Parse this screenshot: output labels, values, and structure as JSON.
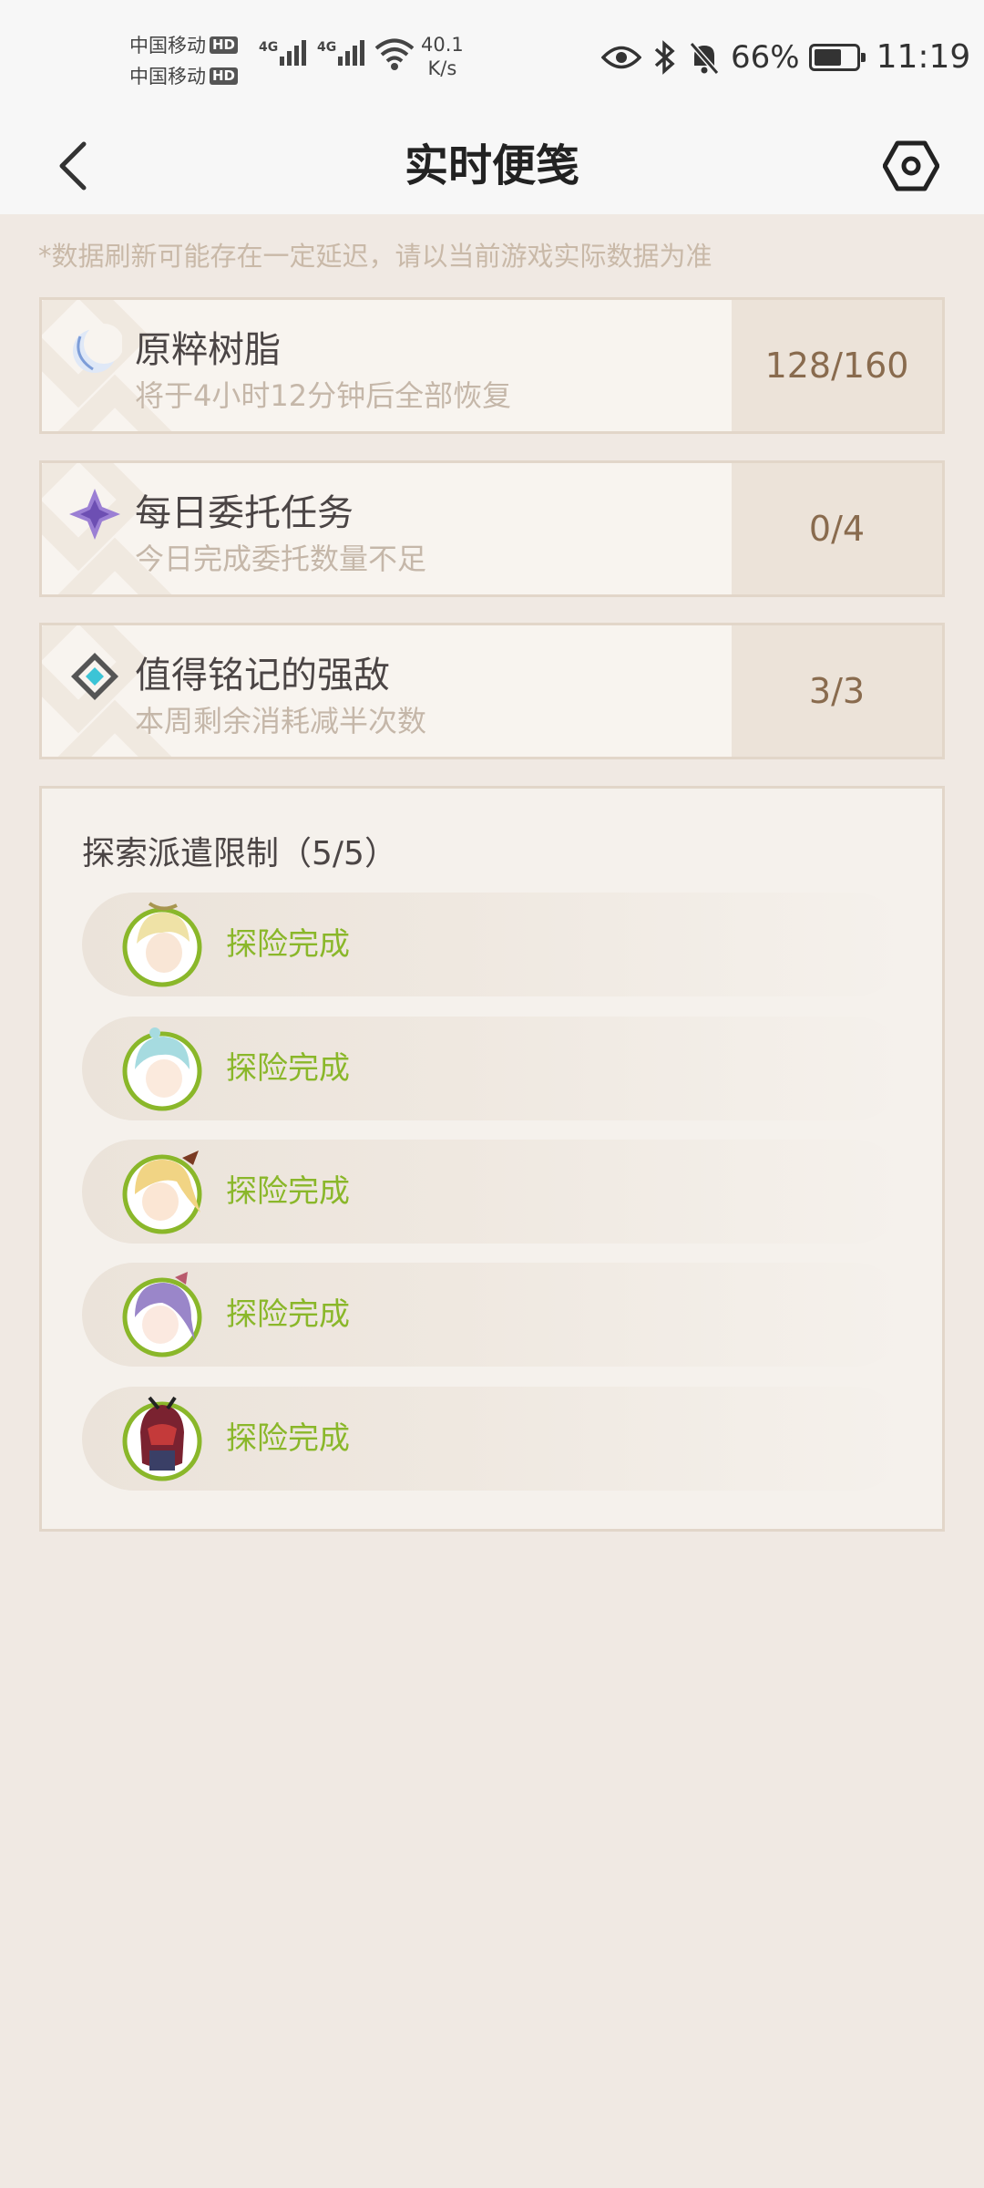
{
  "status_bar": {
    "carrier1": "中国移动",
    "carrier2": "中国移动",
    "hd_badge": "HD",
    "network_type": "4G",
    "net_speed_value": "40.1",
    "net_speed_unit": "K/s",
    "battery_percent": "66%",
    "battery_level": 0.66,
    "time": "11:19"
  },
  "header": {
    "title": "实时便笺",
    "back_icon": "chevron-left-icon",
    "settings_icon": "hexagon-gear-icon"
  },
  "notice": "*数据刷新可能存在一定延迟，请以当前游戏实际数据为准",
  "cards": [
    {
      "icon": "moon-resin-icon",
      "title": "原粹树脂",
      "subtitle": "将于4小时12分钟后全部恢复",
      "value": "128/160"
    },
    {
      "icon": "purple-star-icon",
      "title": "每日委托任务",
      "subtitle": "今日完成委托数量不足",
      "value": "0/4"
    },
    {
      "icon": "diamond-emblem-icon",
      "title": "值得铭记的强敌",
      "subtitle": "本周剩余消耗减半次数",
      "value": "3/3"
    }
  ],
  "expedition": {
    "title": "探索派遣限制（5/5）",
    "items": [
      {
        "status": "探险完成",
        "avatar": "character-avatar-1"
      },
      {
        "status": "探险完成",
        "avatar": "character-avatar-2"
      },
      {
        "status": "探险完成",
        "avatar": "character-avatar-3"
      },
      {
        "status": "探险完成",
        "avatar": "character-avatar-4"
      },
      {
        "status": "探险完成",
        "avatar": "character-avatar-5"
      }
    ]
  },
  "colors": {
    "background": "#f0e9e3",
    "accent_green": "#8ab72a",
    "value_text": "#896b4e",
    "muted_text": "#c5b7a9"
  }
}
